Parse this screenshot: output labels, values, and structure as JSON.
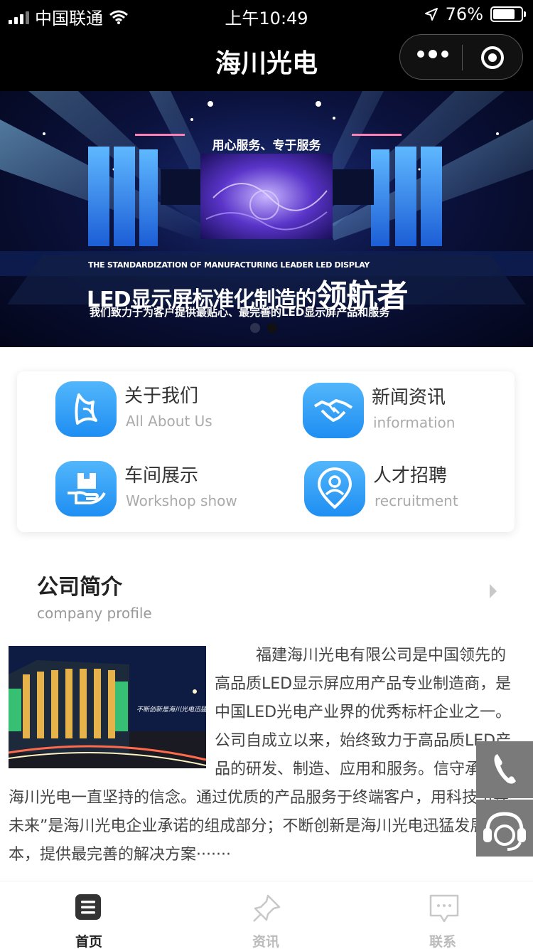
{
  "status_bar": {
    "carrier": "中国联通",
    "time": "上午10:49",
    "battery": "76%"
  },
  "nav": {
    "title": "海川光电"
  },
  "banner": {
    "slogan": "用心服务、专于服务",
    "english_line": "THE STANDARDIZATION OF MANUFACTURING LEADER LED DISPLAY",
    "headline_prefix": "LED显示屏标准化制造的",
    "headline_big": "领航者",
    "subline": "我们致力于为客户提供最贴心、最完善的LED显示屏产品和服务",
    "slide_count": 2,
    "active_slide": 2
  },
  "menu": {
    "items": [
      {
        "title": "关于我们",
        "subtitle": "All About Us",
        "icon": "about-logo-icon"
      },
      {
        "title": "新闻资讯",
        "subtitle": "information",
        "icon": "handshake-icon"
      },
      {
        "title": "车间展示",
        "subtitle": "Workshop show",
        "icon": "box-hand-icon"
      },
      {
        "title": "人才招聘",
        "subtitle": "recruitment",
        "icon": "person-pin-icon"
      }
    ]
  },
  "company": {
    "title": "公司简介",
    "subtitle": "company profile",
    "text": "福建海川光电有限公司是中国领先的高品质LED显示屏应用产品专业制造商，是中国LED光电产业界的优秀标杆企业之一。公司自成立以来，始终致力于高品质LED产品的研发、制造、应用和服务。信守承诺是海川光电一直坚持的信念。通过优质的产品服务于终端客户，用科技引导未来”是海川光电企业承诺的组成部分；不断创新是海川光电迅猛发展的根本，提供最完善的解决方案·······",
    "image_caption": "不断创新是海川光电迅猛发展的根本，提供最完善的解决方案，从不同角度、不同层次保障客户的价值。"
  },
  "float_buttons": [
    {
      "icon": "phone-icon"
    },
    {
      "icon": "customer-service-icon"
    }
  ],
  "tabs": [
    {
      "label": "首页",
      "icon": "home-list-icon",
      "active": true
    },
    {
      "label": "资讯",
      "icon": "pin-icon",
      "active": false
    },
    {
      "label": "联系",
      "icon": "chat-bubble-icon",
      "active": false
    }
  ]
}
